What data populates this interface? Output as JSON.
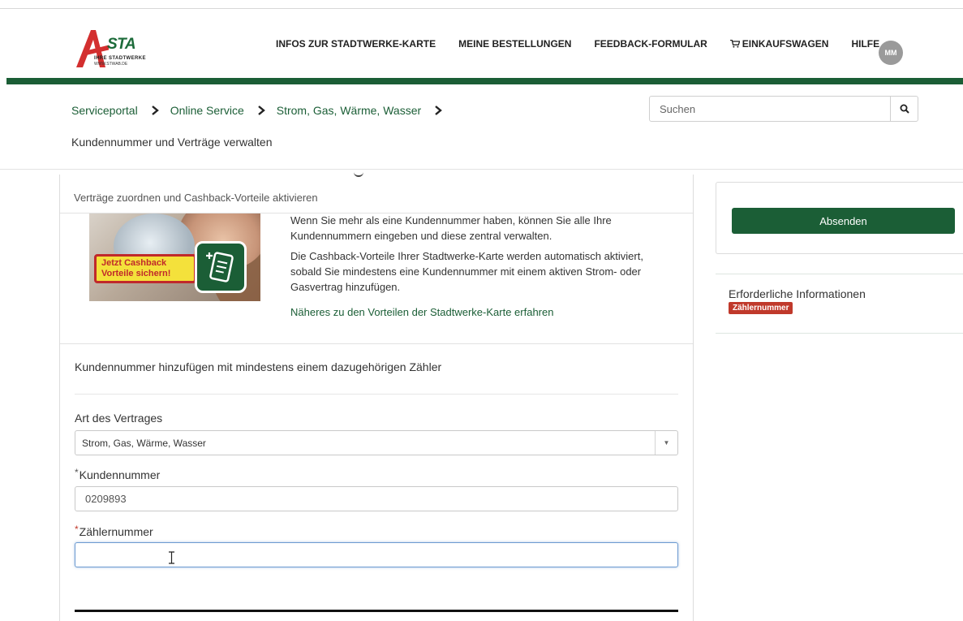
{
  "header": {
    "logo": {
      "sta": "STA",
      "tagline": "IHRE STADTWERKE",
      "url": "WWW.STWAB.DE"
    },
    "nav": [
      "INFOS ZUR STADTWERKE-KARTE",
      "MEINE BESTELLUNGEN",
      "FEEDBACK-FORMULAR",
      "EINKAUFSWAGEN",
      "HILFE"
    ],
    "avatar_initials": "MM"
  },
  "breadcrumb": {
    "items": [
      "Serviceportal",
      "Online Service",
      "Strom, Gas, Wärme, Wasser"
    ],
    "current": "Kundennummer und Verträge verwalten"
  },
  "search": {
    "placeholder": "Suchen"
  },
  "card": {
    "subtitle": "Verträge zuordnen und Cashback-Vorteile aktivieren",
    "promo_badge_line1": "Jetzt Cashback",
    "promo_badge_line2": "Vorteile sichern!",
    "paragraph1": "Wenn Sie mehr als eine Kundennummer haben, können Sie alle Ihre Kundennummern eingeben und diese zentral verwalten.",
    "paragraph2": "Die Cashback-Vorteile Ihrer Stadtwerke-Karte werden automatisch aktiviert, sobald Sie mindestens eine Kundennummer mit einem aktiven Strom- oder Gasvertrag hinzufügen.",
    "link": "Näheres zu den Vorteilen der Stadtwerke-Karte erfahren",
    "section_title": "Kundennummer hinzufügen mit mindestens einem dazugehörigen Zähler"
  },
  "form": {
    "contract_type_label": "Art des Vertrages",
    "contract_type_value": "Strom, Gas, Wärme, Wasser",
    "customer_number_label": "Kundennummer",
    "customer_number_value": "0209893",
    "meter_number_label": "Zählernummer",
    "meter_number_value": "",
    "required_mark": "*"
  },
  "sidebar": {
    "submit_label": "Absenden",
    "required_info_label": "Erforderliche Informationen",
    "required_badge": "Zählernummer"
  },
  "colors": {
    "brand_green": "#1b5e36",
    "required_red": "#c0392b"
  }
}
